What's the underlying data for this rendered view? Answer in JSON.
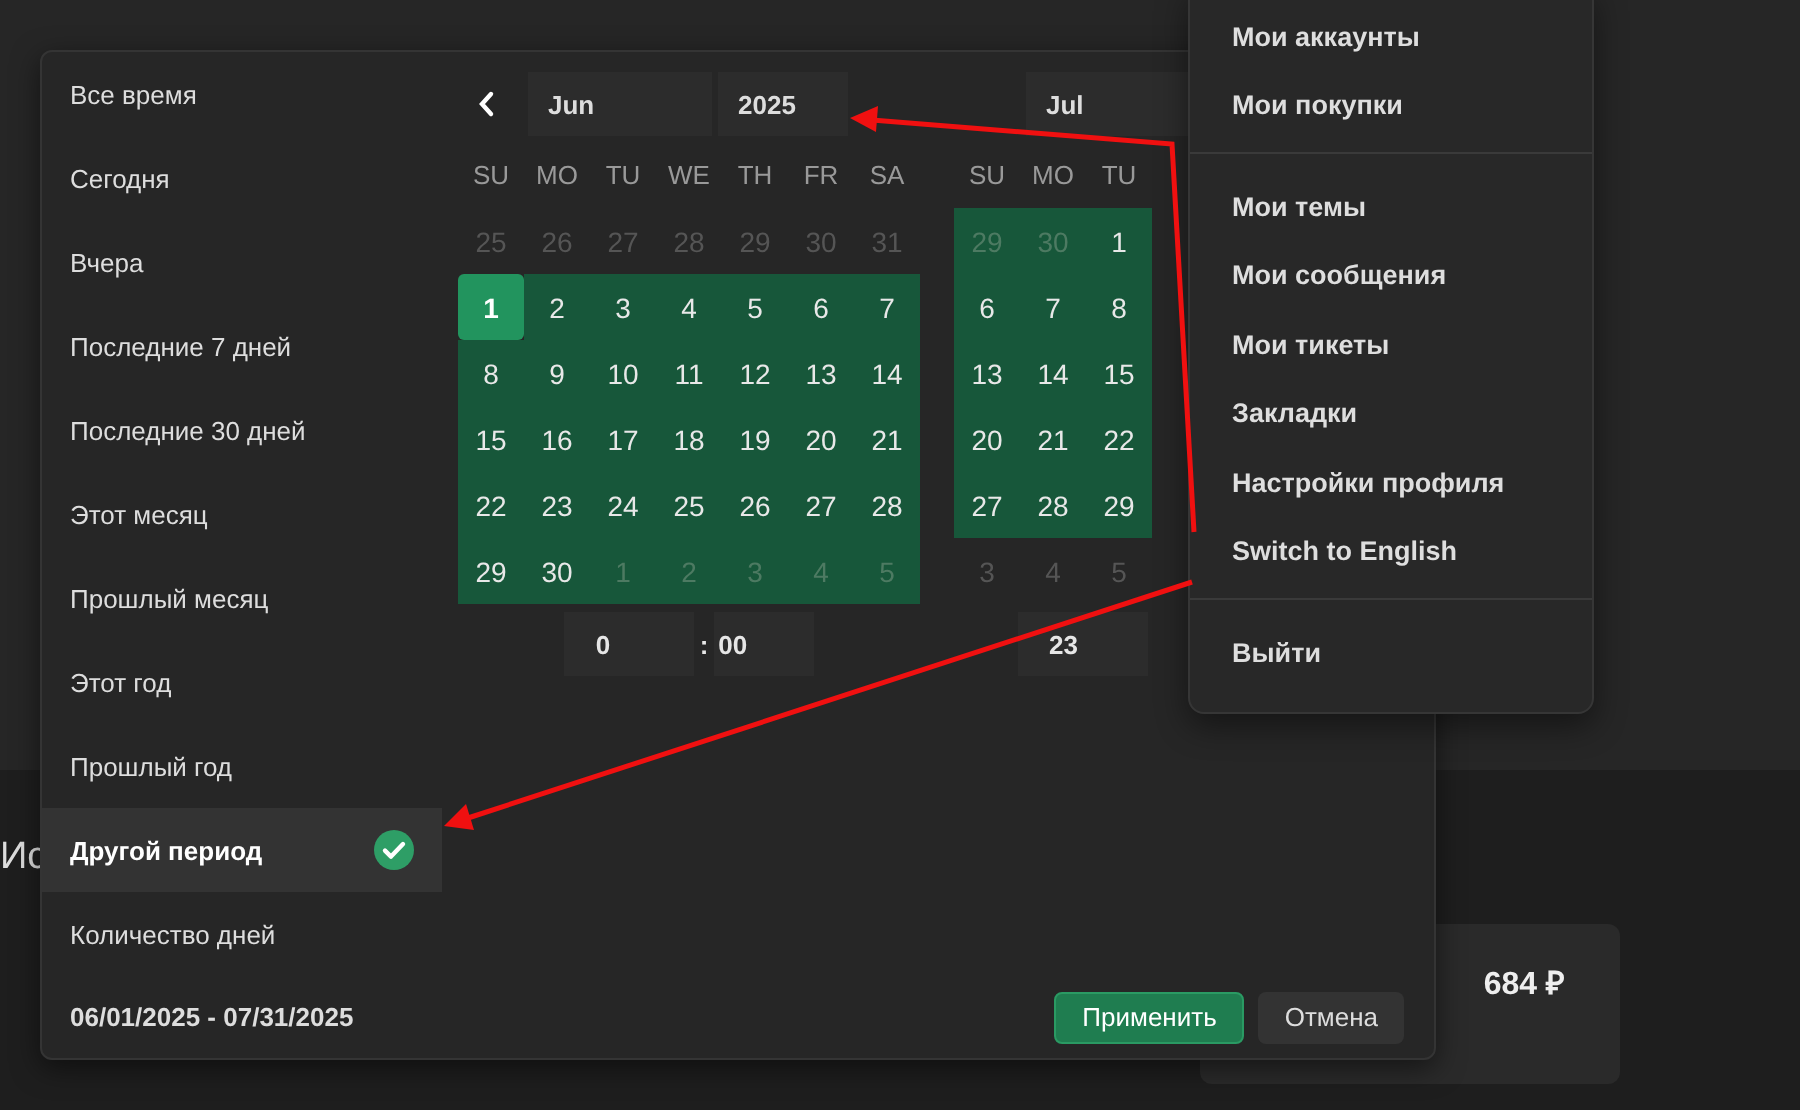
{
  "page": {
    "heading": "Ис",
    "total": "684 ₽"
  },
  "presets": [
    {
      "label": "Все время",
      "selected": false
    },
    {
      "label": "Сегодня",
      "selected": false
    },
    {
      "label": "Вчера",
      "selected": false
    },
    {
      "label": "Последние 7 дней",
      "selected": false
    },
    {
      "label": "Последние 30 дней",
      "selected": false
    },
    {
      "label": "Этот месяц",
      "selected": false
    },
    {
      "label": "Прошлый месяц",
      "selected": false
    },
    {
      "label": "Этот год",
      "selected": false
    },
    {
      "label": "Прошлый год",
      "selected": false
    },
    {
      "label": "Другой период",
      "selected": true
    },
    {
      "label": "Количество дней",
      "selected": false
    }
  ],
  "calendars": [
    {
      "month": "Jun",
      "year": "2025",
      "has_prev": true,
      "weekdays": [
        "SU",
        "MO",
        "TU",
        "WE",
        "TH",
        "FR",
        "SA"
      ],
      "weeks": [
        [
          {
            "d": "25",
            "kind": "outside"
          },
          {
            "d": "26",
            "kind": "outside"
          },
          {
            "d": "27",
            "kind": "outside"
          },
          {
            "d": "28",
            "kind": "outside"
          },
          {
            "d": "29",
            "kind": "outside"
          },
          {
            "d": "30",
            "kind": "outside"
          },
          {
            "d": "31",
            "kind": "outside"
          }
        ],
        [
          {
            "d": "1",
            "kind": "start"
          },
          {
            "d": "2",
            "kind": "range"
          },
          {
            "d": "3",
            "kind": "range"
          },
          {
            "d": "4",
            "kind": "range"
          },
          {
            "d": "5",
            "kind": "range"
          },
          {
            "d": "6",
            "kind": "range"
          },
          {
            "d": "7",
            "kind": "range"
          }
        ],
        [
          {
            "d": "8",
            "kind": "range"
          },
          {
            "d": "9",
            "kind": "range"
          },
          {
            "d": "10",
            "kind": "range"
          },
          {
            "d": "11",
            "kind": "range"
          },
          {
            "d": "12",
            "kind": "range"
          },
          {
            "d": "13",
            "kind": "range"
          },
          {
            "d": "14",
            "kind": "range"
          }
        ],
        [
          {
            "d": "15",
            "kind": "range"
          },
          {
            "d": "16",
            "kind": "range"
          },
          {
            "d": "17",
            "kind": "range"
          },
          {
            "d": "18",
            "kind": "range"
          },
          {
            "d": "19",
            "kind": "range"
          },
          {
            "d": "20",
            "kind": "range"
          },
          {
            "d": "21",
            "kind": "range"
          }
        ],
        [
          {
            "d": "22",
            "kind": "range"
          },
          {
            "d": "23",
            "kind": "range"
          },
          {
            "d": "24",
            "kind": "range"
          },
          {
            "d": "25",
            "kind": "range"
          },
          {
            "d": "26",
            "kind": "range"
          },
          {
            "d": "27",
            "kind": "range"
          },
          {
            "d": "28",
            "kind": "range"
          }
        ],
        [
          {
            "d": "29",
            "kind": "range"
          },
          {
            "d": "30",
            "kind": "range"
          },
          {
            "d": "1",
            "kind": "outside-range"
          },
          {
            "d": "2",
            "kind": "outside-range"
          },
          {
            "d": "3",
            "kind": "outside-range"
          },
          {
            "d": "4",
            "kind": "outside-range"
          },
          {
            "d": "5",
            "kind": "outside-range"
          }
        ]
      ],
      "time": {
        "hours": "0",
        "separator": ":",
        "minutes": "00"
      }
    },
    {
      "month": "Jul",
      "has_prev": false,
      "weekdays": [
        "SU",
        "MO",
        "TU"
      ],
      "weeks": [
        [
          {
            "d": "29",
            "kind": "outside-range"
          },
          {
            "d": "30",
            "kind": "outside-range"
          },
          {
            "d": "1",
            "kind": "range"
          }
        ],
        [
          {
            "d": "6",
            "kind": "range"
          },
          {
            "d": "7",
            "kind": "range"
          },
          {
            "d": "8",
            "kind": "range"
          }
        ],
        [
          {
            "d": "13",
            "kind": "range"
          },
          {
            "d": "14",
            "kind": "range"
          },
          {
            "d": "15",
            "kind": "range"
          }
        ],
        [
          {
            "d": "20",
            "kind": "range"
          },
          {
            "d": "21",
            "kind": "range"
          },
          {
            "d": "22",
            "kind": "range"
          }
        ],
        [
          {
            "d": "27",
            "kind": "range"
          },
          {
            "d": "28",
            "kind": "range"
          },
          {
            "d": "29",
            "kind": "range"
          }
        ],
        [
          {
            "d": "3",
            "kind": "outside"
          },
          {
            "d": "4",
            "kind": "outside"
          },
          {
            "d": "5",
            "kind": "outside"
          }
        ]
      ],
      "time": {
        "hours": "23"
      }
    }
  ],
  "footer": {
    "range": "06/01/2025 - 07/31/2025",
    "buttons": [
      {
        "label": "Применить",
        "kind": "primary"
      },
      {
        "label": "Отмена",
        "kind": "secondary"
      }
    ]
  },
  "menu": {
    "groups": [
      [
        "Мои аккаунты",
        "Мои покупки"
      ],
      [
        "Мои темы",
        "Мои сообщения",
        "Мои тикеты",
        "Закладки",
        "Настройки профиля",
        "Switch to English"
      ],
      [
        "Выйти"
      ]
    ]
  }
}
